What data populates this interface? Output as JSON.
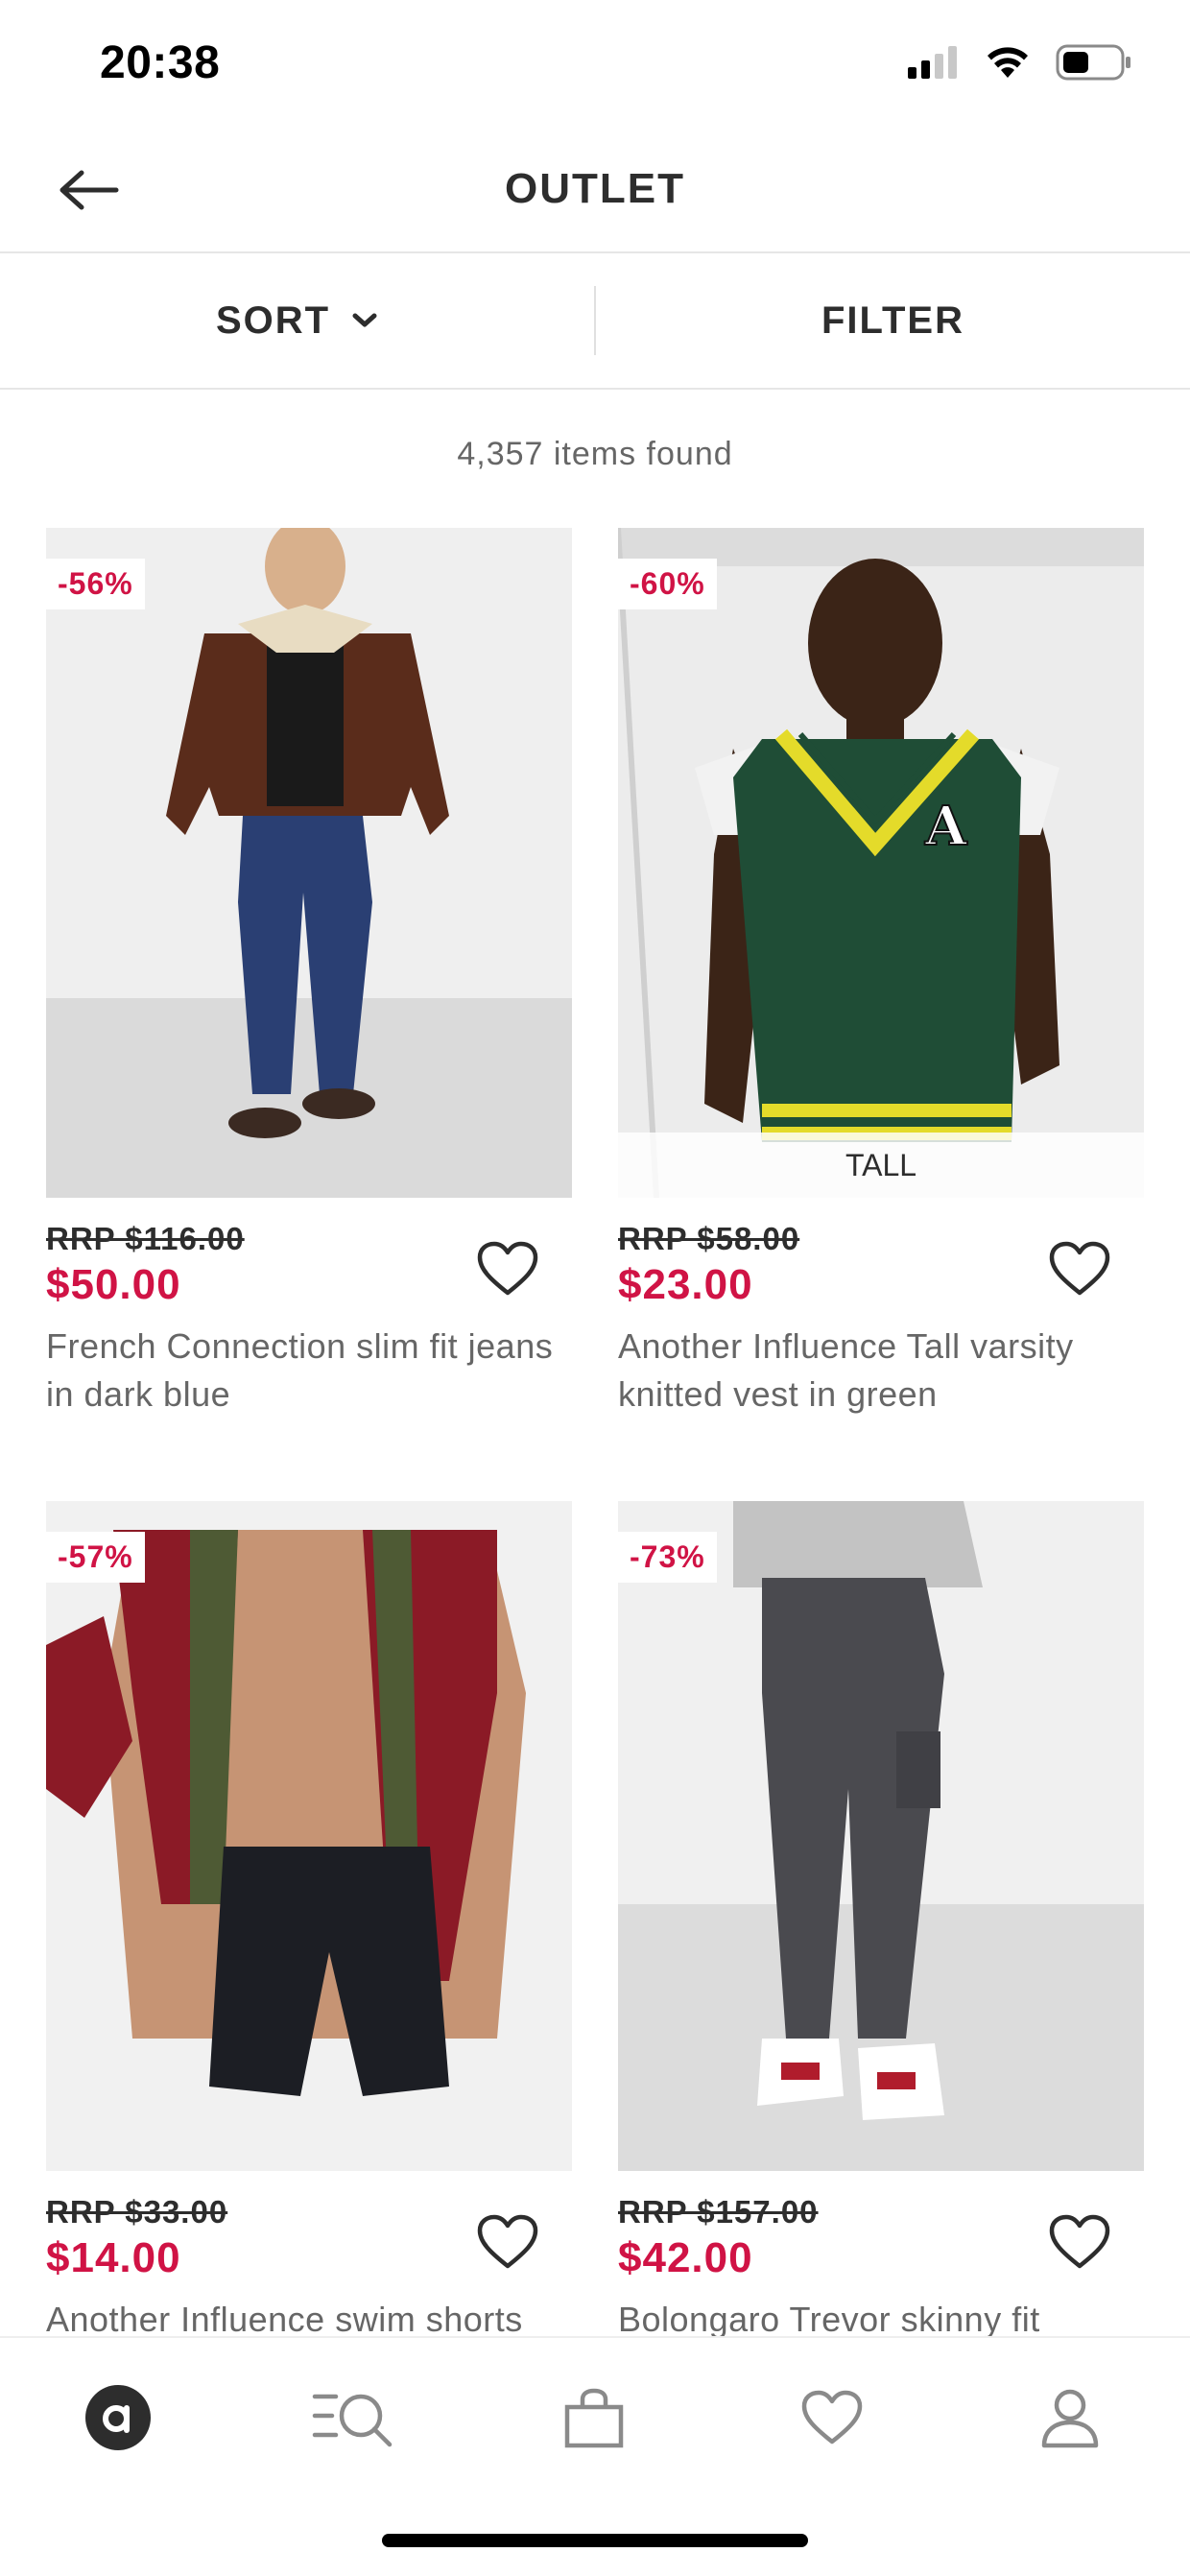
{
  "status": {
    "time": "20:38"
  },
  "header": {
    "title": "OUTLET"
  },
  "toolbar": {
    "sort_label": "SORT",
    "filter_label": "FILTER"
  },
  "results": {
    "count_text": "4,357 items found"
  },
  "products": [
    {
      "discount": "-56%",
      "rrp": "RRP $116.00",
      "price": "$50.00",
      "name": "French Connection slim fit jeans in dark blue",
      "tag": ""
    },
    {
      "discount": "-60%",
      "rrp": "RRP $58.00",
      "price": "$23.00",
      "name": "Another Influence Tall varsity knitted vest in green",
      "tag": "TALL"
    },
    {
      "discount": "-57%",
      "rrp": "RRP $33.00",
      "price": "$14.00",
      "name": "Another Influence swim shorts",
      "tag": ""
    },
    {
      "discount": "-73%",
      "rrp": "RRP $157.00",
      "price": "$42.00",
      "name": "Bolongaro Trevor skinny fit",
      "tag": ""
    }
  ],
  "bottom_nav": [
    {
      "icon": "home-logo-icon"
    },
    {
      "icon": "search-icon"
    },
    {
      "icon": "bag-icon"
    },
    {
      "icon": "heart-icon"
    },
    {
      "icon": "account-icon"
    }
  ],
  "colors": {
    "sale": "#d01345",
    "text": "#2d2d2d",
    "muted": "#666666"
  }
}
